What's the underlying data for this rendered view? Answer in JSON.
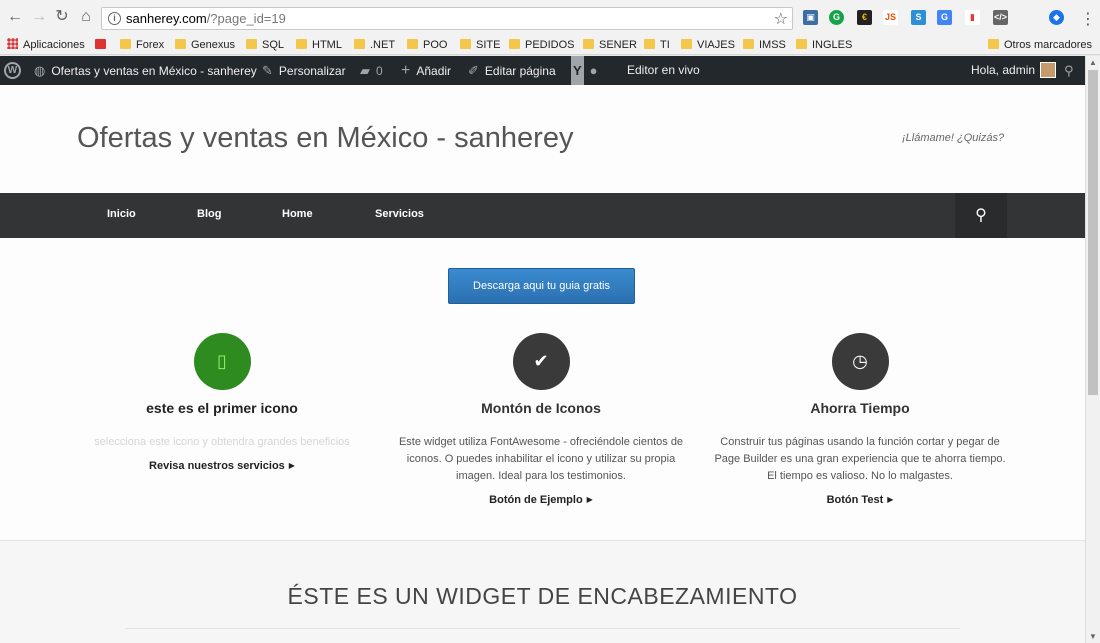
{
  "browser": {
    "url_host": "sanherey.com",
    "url_path": "/?page_id=19"
  },
  "bookmarks": {
    "apps": "Aplicaciones",
    "items": [
      "Forex",
      "Genexus",
      "SQL",
      "HTML",
      ".NET",
      "POO",
      "SITE",
      "PEDIDOS",
      "SENER",
      "TI",
      "VIAJES",
      "IMSS",
      "INGLES"
    ],
    "other": "Otros marcadores"
  },
  "adminbar": {
    "site_name": "Ofertas y ventas en México - sanherey",
    "customize": "Personalizar",
    "comments": "0",
    "new": "Añadir",
    "edit": "Editar página",
    "live_editor": "Editor en vivo",
    "greeting": "Hola, admin"
  },
  "site": {
    "title": "Ofertas y ventas en México - sanherey",
    "tagline": "¡Llámame! ¿Quizás?"
  },
  "nav": [
    "Inicio",
    "Blog",
    "Home",
    "Servicios"
  ],
  "cta": "Descarga aqui tu guia gratis",
  "features": [
    {
      "icon": "mobile-icon",
      "title": "este es el primer icono",
      "text": "selecciona este icono y obtendra grandes beneficios",
      "link": "Revisa nuestros servicios"
    },
    {
      "icon": "check-circle-icon",
      "title": "Montón de Iconos",
      "text": "Este widget utiliza FontAwesome - ofreciéndole cientos de iconos. O puedes inhabilitar el icono y utilizar su propia imagen. Ideal para los testimonios.",
      "link": "Botón de Ejemplo"
    },
    {
      "icon": "clock-icon",
      "title": "Ahorra Tiempo",
      "text": "Construir tus páginas usando la función cortar y pegar de Page Builder es una gran experiencia que te ahorra tiempo. El tiempo es valioso. No lo malgastes.",
      "link": "Botón Test"
    }
  ],
  "section2": {
    "heading": "ÉSTE ES UN WIDGET DE ENCABEZAMIENTO"
  },
  "colors": {
    "adminbar": "#23282d",
    "nav": "#333436",
    "cta": "#2b70b1",
    "green_icon": "#2e8b1f"
  }
}
